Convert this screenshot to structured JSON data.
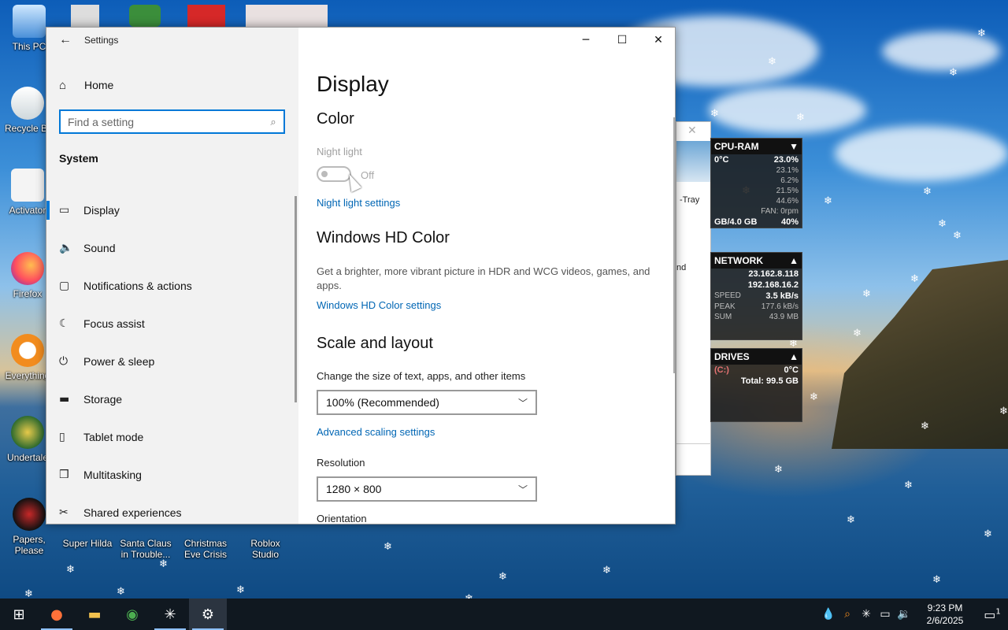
{
  "window": {
    "title": "Settings",
    "back_glyph": "←",
    "minimize_glyph": "─",
    "maximize_glyph": "☐",
    "close_glyph": "✕"
  },
  "sidebar": {
    "home_label": "Home",
    "search_placeholder": "Find a setting",
    "group_label": "System",
    "items": [
      {
        "label": "Display",
        "icon": "monitor-icon",
        "glyph": "▭",
        "active": true
      },
      {
        "label": "Sound",
        "icon": "speaker-icon",
        "glyph": "🔈"
      },
      {
        "label": "Notifications & actions",
        "icon": "notification-icon",
        "glyph": "▢"
      },
      {
        "label": "Focus assist",
        "icon": "moon-icon",
        "glyph": "☾"
      },
      {
        "label": "Power & sleep",
        "icon": "power-icon",
        "glyph": "⏻"
      },
      {
        "label": "Storage",
        "icon": "storage-icon",
        "glyph": "▬"
      },
      {
        "label": "Tablet mode",
        "icon": "tablet-icon",
        "glyph": "▯"
      },
      {
        "label": "Multitasking",
        "icon": "multitasking-icon",
        "glyph": "❒"
      },
      {
        "label": "Shared experiences",
        "icon": "share-icon",
        "glyph": "✂"
      }
    ]
  },
  "content": {
    "page_title": "Display",
    "color_section": "Color",
    "night_light_label": "Night light",
    "night_light_state": "Off",
    "night_light_link": "Night light settings",
    "hd_section": "Windows HD Color",
    "hd_desc": "Get a brighter, more vibrant picture in HDR and WCG videos, games, and apps.",
    "hd_link": "Windows HD Color settings",
    "scale_section": "Scale and layout",
    "scale_label": "Change the size of text, apps, and other items",
    "scale_value": "100% (Recommended)",
    "scale_link": "Advanced scaling settings",
    "resolution_label": "Resolution",
    "resolution_value": "1280 × 800",
    "orientation_label": "Orientation"
  },
  "desktop_icons": [
    {
      "label": "This PC"
    },
    {
      "label": "Recycle Bin"
    },
    {
      "label": "Activator"
    },
    {
      "label": "Firefox"
    },
    {
      "label": "Everything"
    },
    {
      "label": "Undertale"
    },
    {
      "label": "Papers, Please"
    },
    {
      "label": "Super Hilda"
    },
    {
      "label": "Santa Claus in Trouble..."
    },
    {
      "label": "Christmas Eve Crisis"
    },
    {
      "label": "Roblox Studio"
    }
  ],
  "meter_window": {
    "tray_label": "-Tray",
    "and_label": "nd"
  },
  "gadget": {
    "cpu_title": "CPU-RAM",
    "temp": "0°C",
    "cpu_total": "23.0%",
    "cores": [
      "23.1%",
      "6.2%",
      "21.5%",
      "44.6%"
    ],
    "fan": "FAN: 0rpm",
    "ram": "GB/4.0 GB",
    "ram_pct": "40%",
    "net_title": "NETWORK",
    "ip1": "23.162.8.118",
    "ip2": "192.168.16.2",
    "speed_label": "SPEED",
    "speed": "3.5 kB/s",
    "peak_label": "PEAK",
    "peak": "177.6 kB/s",
    "sum_label": "SUM",
    "sum": "43.9 MB",
    "drives_title": "DRIVES",
    "drive": "(C:)",
    "drive_temp": "0°C",
    "drive_total": "Total: 99.5 GB"
  },
  "taskbar": {
    "time": "9:23 PM",
    "date": "2/6/2025",
    "notif_count": "1"
  },
  "colors": {
    "accent": "#0078d7",
    "link": "#0066b4",
    "taskbar": "#101820"
  }
}
